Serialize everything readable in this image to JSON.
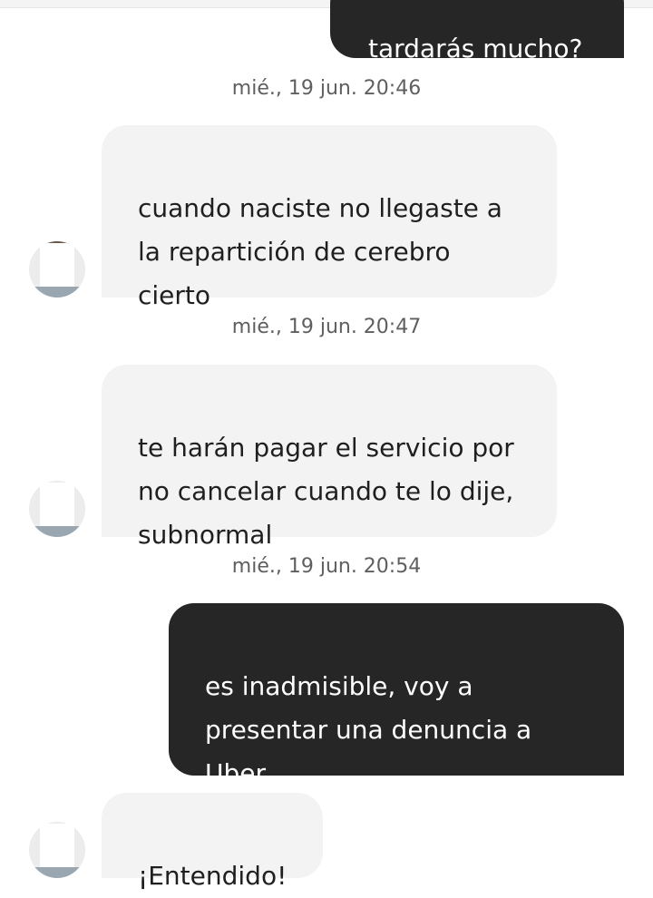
{
  "colors": {
    "incoming_bubble": "#f3f3f3",
    "outgoing_bubble": "#262626",
    "timestamp_text": "#5f5f5f"
  },
  "messages": {
    "partial_outgoing": "tardarás mucho?",
    "ts1": "mié., 19 jun. 20:46",
    "msg1": "cuando naciste no llegaste a\nla repartición de cerebro\ncierto",
    "ts2": "mié., 19 jun. 20:47",
    "msg2": "te harán pagar el servicio por\nno cancelar cuando te lo dije,\nsubnormal",
    "ts3": "mié., 19 jun. 20:54",
    "msg3": "es inadmisible, voy a\npresentar una denuncia a\nUber",
    "msg4": "¡Entendido!"
  },
  "icons": {
    "avatar": "driver-avatar-icon"
  }
}
